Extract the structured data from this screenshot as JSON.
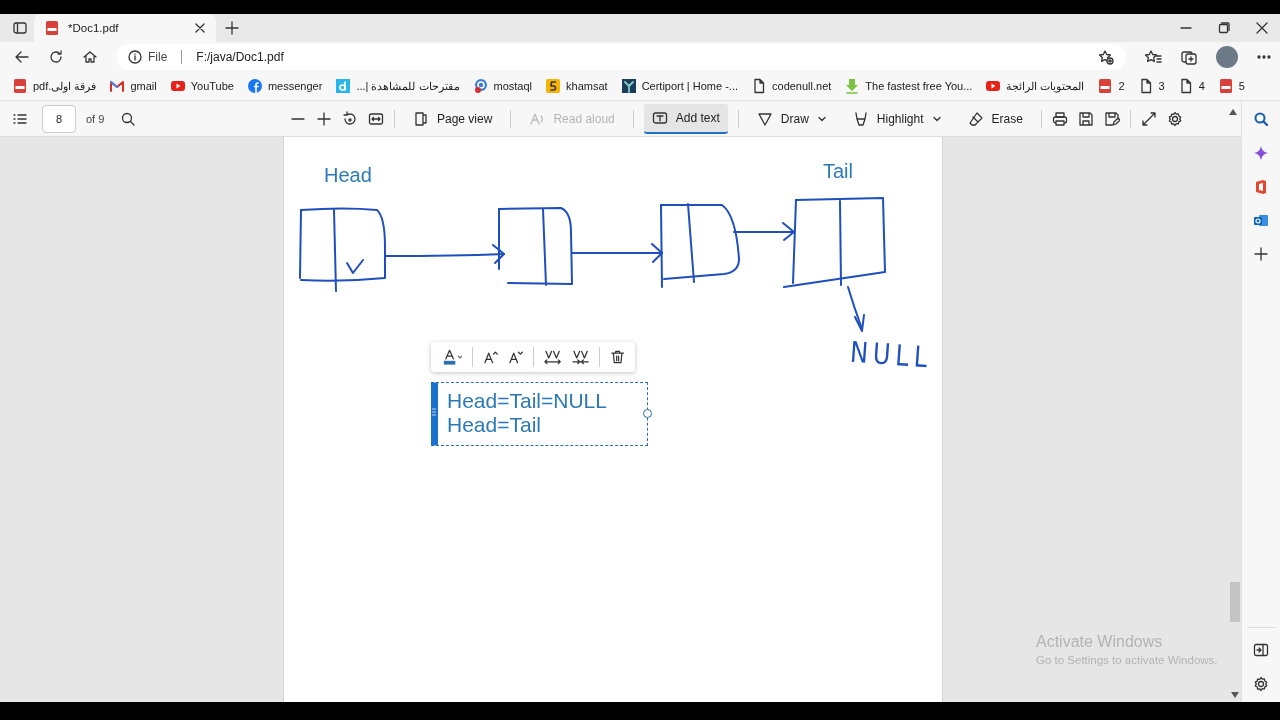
{
  "browser": {
    "tab": {
      "title": "*Doc1.pdf",
      "selected": true
    },
    "address": {
      "scheme": "File",
      "url": "F:/java/Doc1.pdf"
    }
  },
  "bookmarks": [
    {
      "kind": "pdf",
      "label": "فرقة اولى.pdf"
    },
    {
      "kind": "gmail",
      "label": "gmail"
    },
    {
      "kind": "youtube",
      "label": "YouTube"
    },
    {
      "kind": "facebook",
      "label": "messenger"
    },
    {
      "kind": "d",
      "label": "مقترحات للمشاهدة |..."
    },
    {
      "kind": "q",
      "label": "mostaql"
    },
    {
      "kind": "five",
      "label": "khamsat"
    },
    {
      "kind": "certiport",
      "label": "Certiport | Home -..."
    },
    {
      "kind": "file",
      "label": "codenull.net"
    },
    {
      "kind": "download",
      "label": "The fastest free You..."
    },
    {
      "kind": "youtube",
      "label": "المحتويات الرائجة"
    },
    {
      "kind": "pdf",
      "label": "2"
    },
    {
      "kind": "file",
      "label": "3"
    },
    {
      "kind": "file",
      "label": "4"
    },
    {
      "kind": "pdf",
      "label": "5"
    }
  ],
  "pdf_toolbar": {
    "page": "8",
    "page_count": "of 9",
    "tools": [
      {
        "kind": "page-view",
        "label": "Page view",
        "selected": false,
        "disabled": false,
        "has_menu": false
      },
      {
        "kind": "read-aloud",
        "label": "Read aloud",
        "selected": false,
        "disabled": true,
        "has_menu": false
      },
      {
        "kind": "add-text",
        "label": "Add text",
        "selected": true,
        "disabled": false,
        "has_menu": false
      },
      {
        "kind": "draw",
        "label": "Draw",
        "selected": false,
        "disabled": false,
        "has_menu": true
      },
      {
        "kind": "highlight",
        "label": "Highlight",
        "selected": false,
        "disabled": false,
        "has_menu": true
      },
      {
        "kind": "erase",
        "label": "Erase",
        "selected": false,
        "disabled": false,
        "has_menu": false
      }
    ]
  },
  "document": {
    "head_label": "Head",
    "tail_label": "Tail",
    "null_note": "NULL",
    "text_box": {
      "lines": [
        "Head=Tail=NULL",
        "Head=Tail"
      ]
    }
  },
  "activation_notice": {
    "title": "Activate Windows",
    "subtitle": "Go to Settings to activate Windows."
  }
}
